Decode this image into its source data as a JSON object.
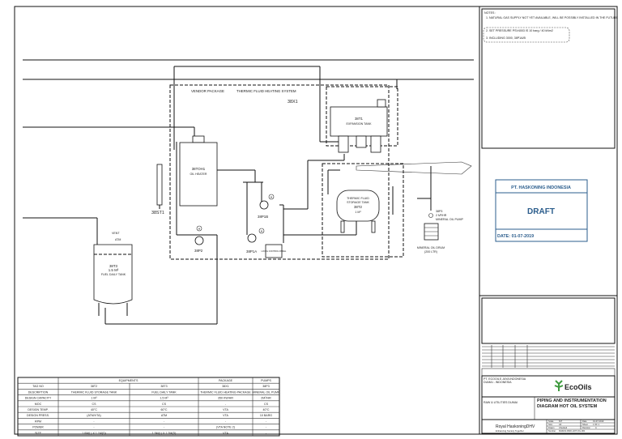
{
  "notes": {
    "title": "NOTES :",
    "items": [
      "1.   NATURAL GAS SUPPLY NOT YET AVAILABLE, WILL BE POSSIBLY INSTALLED IN THE FUTURE",
      "2.   SET PRESSURE PSV4003 IS 10 barg / 40 kNm2",
      "3.   INCLUDING 3000, 38P1A/B"
    ]
  },
  "stamp": {
    "company": "PT. HASKONING INDONESIA",
    "status": "DRAFT",
    "date": "DATE: 01-07-2019"
  },
  "diagram": {
    "vendor_package": "VENDOR PACKAGE",
    "system_title": "THERMIC FLUID HEATING SYSTEM",
    "system_tag": "38X1",
    "heater_tag": "38TOH1",
    "heater_name": "OIL HEATER",
    "expansion_tag": "38T1",
    "expansion_name": "EXPANSION TANK",
    "storage_tag": "38T2",
    "storage_name1": "THERMIC FLUID",
    "storage_name2": "STORAGE TANK",
    "storage_cap": "1 M³",
    "daily_tag": "38T3",
    "daily_cap": "1.5 M³",
    "daily_name": "FUEL DAILY TANK",
    "stack_tag": "38ST1",
    "pump_1a": "38P1A",
    "pump_1b": "38P1B",
    "pump_2": "38P2",
    "pump_3_tag": "38P3",
    "pump_3_cap": "2 M³/HR",
    "pump_3_name": "MINERAL OIL PUMP",
    "drum_name": "MINERAL OIL DRUM",
    "drum_cap": "(200 LTR)",
    "control_panel": "LOCAL CONTROL PANEL",
    "vent": "VENT",
    "atm": "ATM",
    "motor": "M"
  },
  "equipment_table": {
    "groups": [
      "EQUIPMENTS",
      "PACKAGE",
      "PUMPS"
    ],
    "rows": [
      {
        "label": "TAG NO",
        "values": [
          "38T2",
          "38T3",
          "38X1",
          "38P3"
        ]
      },
      {
        "label": "DESCRIPTION",
        "values": [
          "THERMIC FLUID STORAGE TANK",
          "FUEL DAILY TANK",
          "THERMIC FLUID HEATING PACKAGE",
          "MINERAL OIL PUMP"
        ]
      },
      {
        "label": "DESIGN CAPACITY",
        "values": [
          "1 M³",
          "1.5 M³",
          "350 KW/HR",
          "2M³/HR"
        ]
      },
      {
        "label": "MOC",
        "values": [
          "CS",
          "CS",
          "-",
          "CS"
        ]
      },
      {
        "label": "DESIGN TEMP.",
        "values": [
          "40°C",
          "60°C",
          "VTA",
          "40°C"
        ]
      },
      {
        "label": "DESIGN PRESS.",
        "values": [
          "(ATM/VTA)",
          "ATM",
          "VTA",
          "10 BARG"
        ]
      },
      {
        "label": "RPM",
        "values": [
          "-",
          "-",
          "-",
          "-"
        ]
      },
      {
        "label": "POWER",
        "values": [
          "-",
          "-",
          "(VTA NOTE 2)",
          "-"
        ]
      },
      {
        "label": "SIZE",
        "values": [
          "1.0M(L) X 1.1M(D)",
          "1.5M(L) X 1.2M(D)",
          "VTA",
          "-"
        ]
      }
    ]
  },
  "title_block": {
    "client": "PT. ECOOILS JAYA INDONESIA",
    "client_location": "DUMAI - INDONESIA",
    "client_logo": "EcoOils",
    "project": "RAW & UTILITIES DUMAI",
    "drawing_title": "PIPING AND INSTRUMENTATION DIAGRAM HOT OIL SYSTEM",
    "consultant_logo": "Royal HaskoningDHV",
    "consultant_tagline": "Enhancing Society Together",
    "fields": [
      {
        "label": "Scale",
        "value": "N/T"
      },
      {
        "label": "Date",
        "value": "01-07-2019"
      },
      {
        "label": "Size",
        "value": "A3"
      },
      {
        "label": "Sheet",
        "value": "1 OF 1"
      },
      {
        "label": "Drawn",
        "value": "Checked"
      },
      {
        "label": "Revision",
        "value": "A"
      },
      {
        "label": "Number",
        "value": "RHDHV-P&ID-HOT-OIL-001"
      }
    ]
  }
}
